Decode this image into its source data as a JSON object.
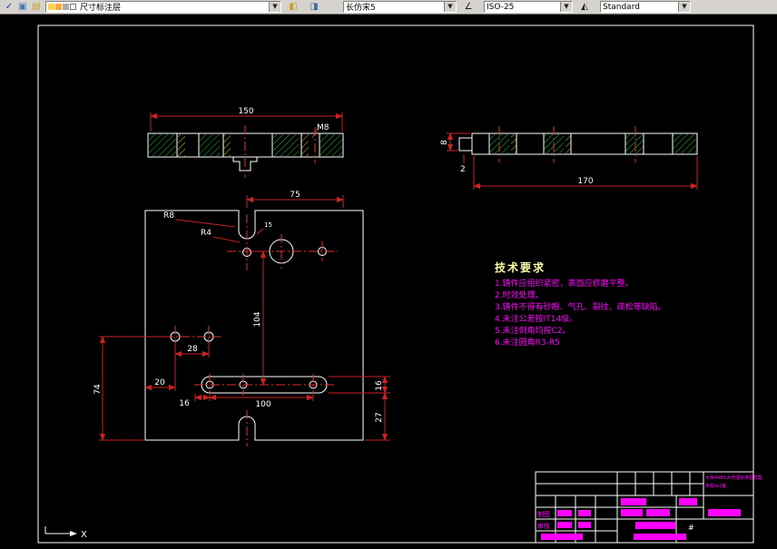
{
  "colors": {
    "toolbar_bg": "#d6d3ce",
    "canvas_bg": "#000000",
    "line": "#ffffff",
    "dim": "#cc2222",
    "centerline": "#e03030",
    "hatch_green": "#00c832",
    "hatch_yellow": "#c8c800",
    "annotation": "#ff00ff",
    "tech_title": "#ffffaa"
  },
  "toolbar": {
    "layer_value": "尺寸标注层",
    "font_value": "长仿宋5",
    "dimstyle_value": "ISO-25",
    "textstyle_value": "Standard",
    "dropdown_arrow": "▼",
    "icons": [
      {
        "name": "check-icon",
        "glyph": "✓"
      },
      {
        "name": "clipboard-icon",
        "glyph": "▣"
      },
      {
        "name": "layers-icon",
        "glyph": "▤"
      },
      {
        "name": "layer-previous-icon",
        "glyph": "◧"
      },
      {
        "name": "font-icon",
        "glyph": "◨"
      },
      {
        "name": "dim-style-icon",
        "glyph": "∠"
      },
      {
        "name": "text-style-icon",
        "glyph": "◭"
      }
    ]
  },
  "drawing": {
    "dims": {
      "top_width": "150",
      "thread": "M8",
      "sec_h1": "8",
      "sec_h2": "2",
      "sec_width": "170",
      "front_width": "75",
      "radius_large": "R8",
      "radius_small": "R4",
      "chamfer": "15",
      "height_mid": "104",
      "height_left": "74",
      "offset_left": "20",
      "hole_spacing": "28",
      "slot_offset": "16",
      "slot_span": "100",
      "slot_height": "16",
      "bottom_height": "27"
    },
    "ucs_x": "X"
  },
  "tech": {
    "title": "技术要求",
    "items": [
      "1.铸件应组织紧密，表面应修磨平整。",
      "2.时效处理。",
      "3.铸件不得有砂眼、气孔、裂纹、疏松等缺陷。",
      "4.未注公差按IT14级。",
      "5.未注倒角均按C2。",
      "6.未注圆角R3-R5"
    ]
  },
  "title_block": {
    "name_line1": "大柴498X大修理标准图样集",
    "name_line2": "柴辊№2备",
    "row1_label": "制图",
    "row2_label": "审核",
    "sheet_mark": "#"
  }
}
